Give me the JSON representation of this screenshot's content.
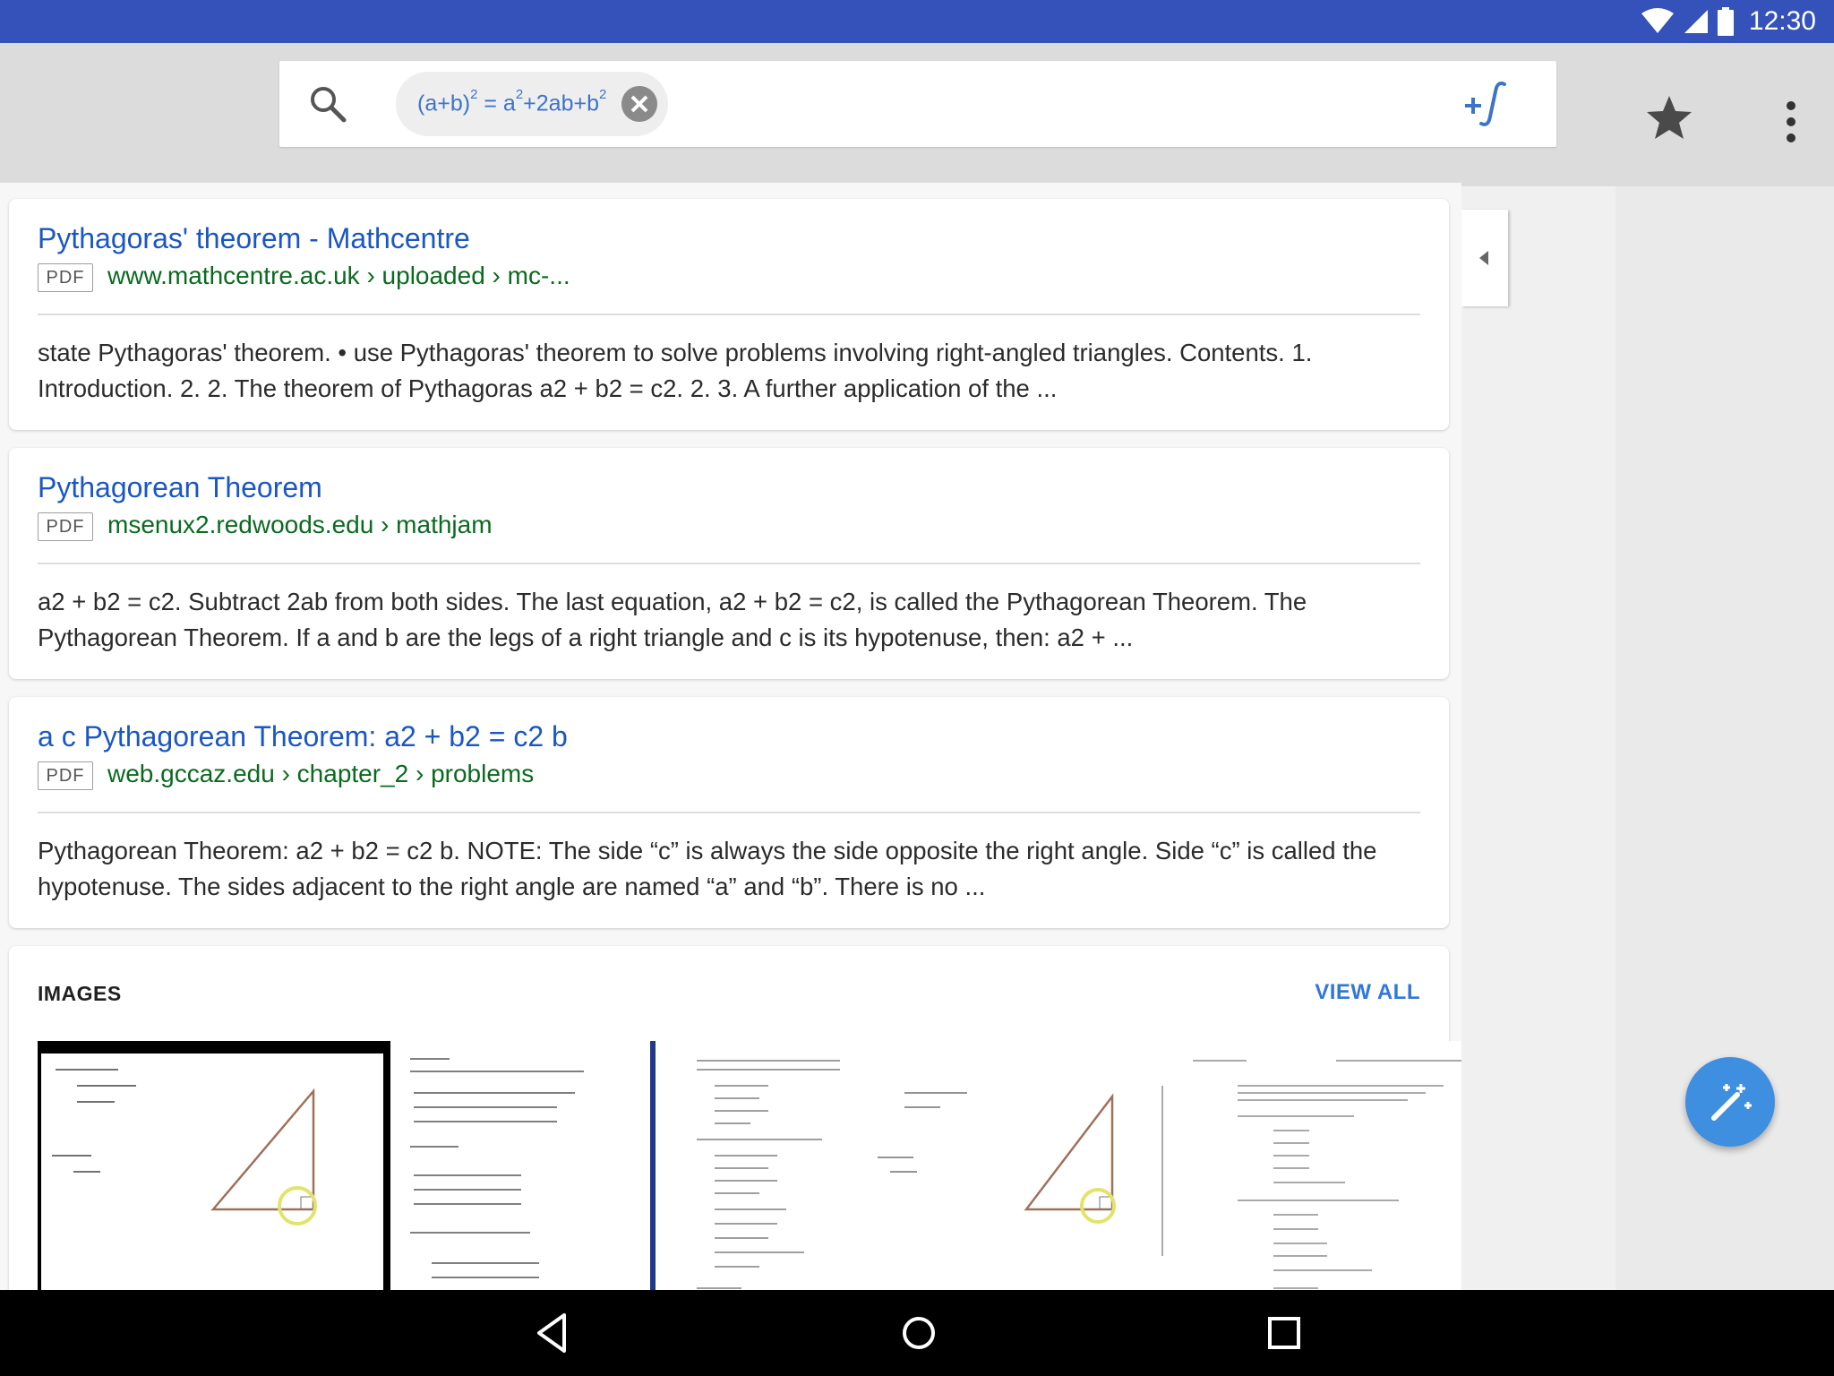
{
  "status_bar": {
    "time": "12:30"
  },
  "search": {
    "query_base": "(a+b)",
    "query_exp1": "2",
    "query_mid": " = a",
    "query_exp2": "2",
    "query_rest": "+2ab+b",
    "query_exp3": "2"
  },
  "results": [
    {
      "title": "Pythagoras' theorem - Mathcentre",
      "badge": "PDF",
      "url": "www.mathcentre.ac.uk › uploaded › mc-...",
      "snippet": "state Pythagoras' theorem. • use Pythagoras' theorem to solve problems involving right-angled triangles. Contents. 1. Introduction. 2. 2. The theorem of Pythagoras a2 + b2 = c2. 2. 3. A further application of the ..."
    },
    {
      "title": "Pythagorean Theorem",
      "badge": "PDF",
      "url": "msenux2.redwoods.edu › mathjam",
      "snippet": "a2 + b2 = c2. Subtract 2ab from both sides. The last equation, a2 + b2 = c2, is called the Pythagorean Theorem. The Pythagorean Theorem. If a and b are the legs of a right triangle and c is its hypotenuse, then: a2 + ..."
    },
    {
      "title": "a c Pythagorean Theorem: a2 + b2 = c2 b",
      "badge": "PDF",
      "url": "web.gccaz.edu › chapter_2 › problems",
      "snippet": "Pythagorean Theorem: a2 + b2 = c2 b. NOTE: The side “c” is always the side opposite the right angle. Side “c” is called the hypotenuse. The sides adjacent to the right angle are named “a” and “b”. There is no ..."
    }
  ],
  "images": {
    "label": "IMAGES",
    "view_all": "VIEW ALL"
  },
  "colors": {
    "status_bar": "#3452ba",
    "link_blue": "#1a57c2",
    "url_green": "#0a6a1f",
    "fab": "#3f8fe0"
  },
  "icons": [
    "wifi-icon",
    "signal-icon",
    "battery-icon",
    "search-icon",
    "clear-icon",
    "math-function-icon",
    "star-icon",
    "more-vert-icon",
    "collapse-arrow-icon",
    "magic-wand-icon",
    "back-icon",
    "home-icon",
    "recents-icon"
  ]
}
